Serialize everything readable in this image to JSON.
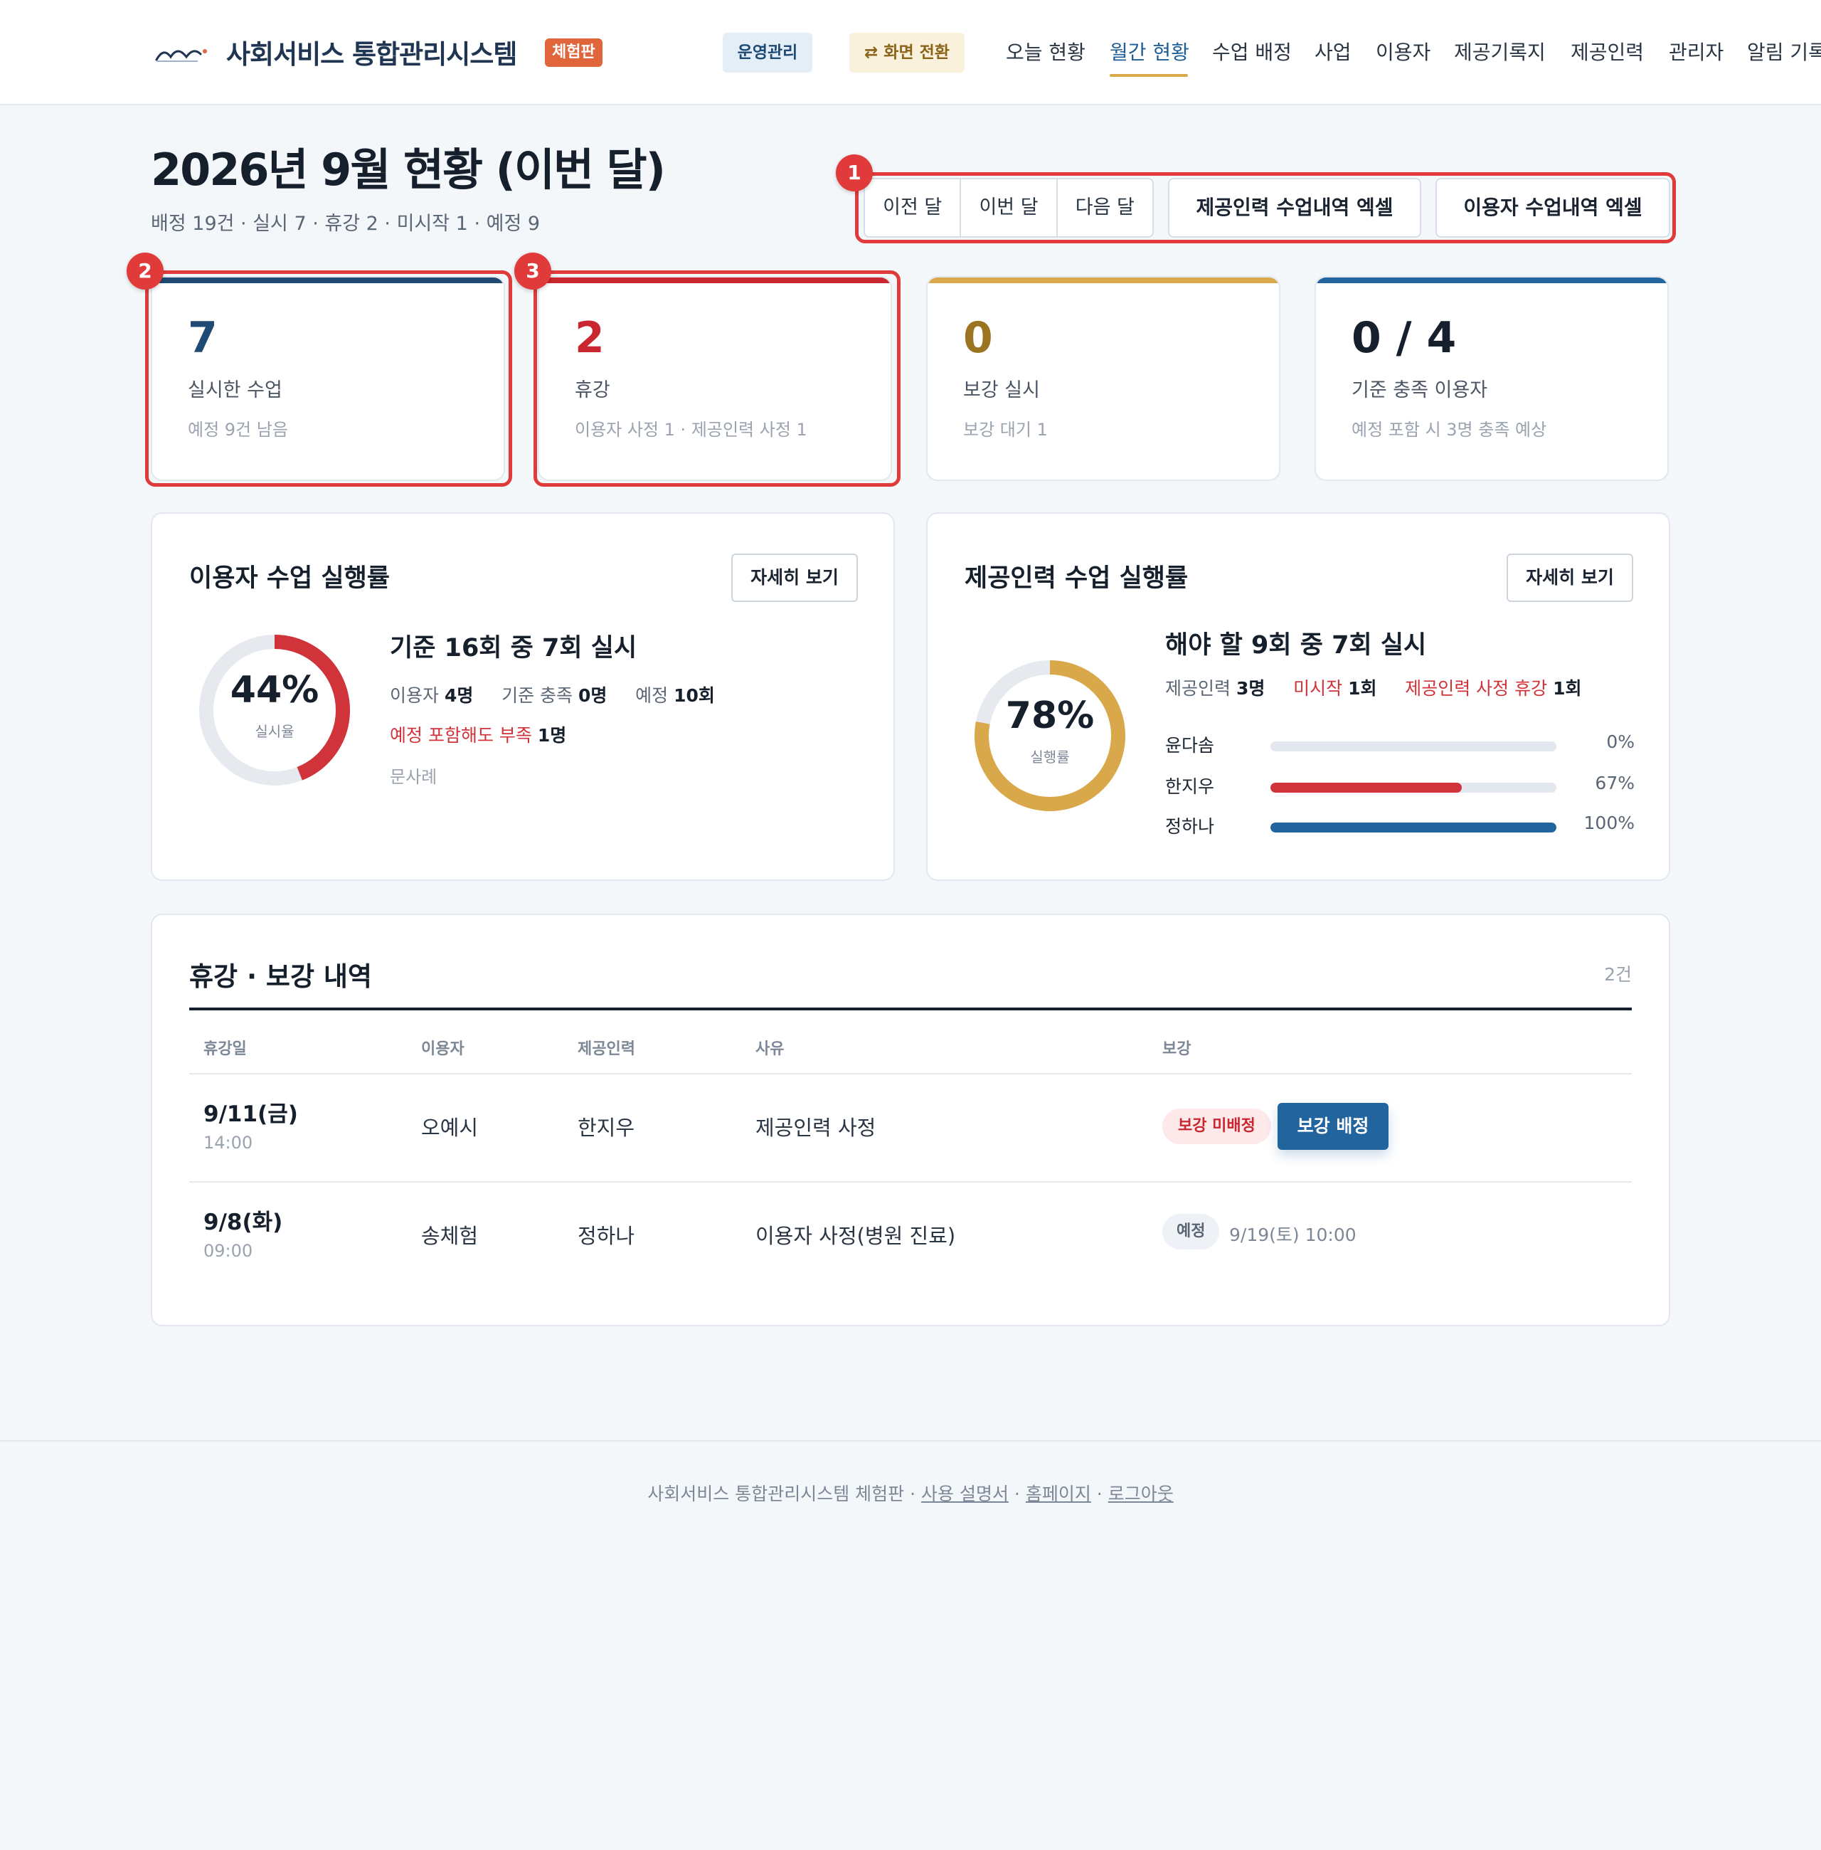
{
  "header": {
    "brand_title": "사회서비스 통합관리시스템",
    "trial_badge": "체험판",
    "ops_button": "운영관리",
    "switch_button": "⇄ 화면 전환",
    "nav": [
      "오늘 현황",
      "월간 현황",
      "수업 배정",
      "사업",
      "이용자",
      "제공기록지",
      "제공인력",
      "관리자",
      "알림 기록"
    ],
    "active_nav": "월간 현황"
  },
  "page": {
    "title": "2026년 9월 현황 (이번 달)",
    "subtitle": "배정 19건 · 실시 7 · 휴강 2 · 미시작 1 · 예정 9",
    "month_buttons": [
      "이전 달",
      "이번 달",
      "다음 달"
    ],
    "excel_provider": "제공인력 수업내역 엑셀",
    "excel_user": "이용자 수업내역 엑셀"
  },
  "annotations": [
    "1",
    "2",
    "3"
  ],
  "stats": [
    {
      "value": "7",
      "label": "실시한 수업",
      "note": "예정 9건 남음",
      "color": "#1f4a74"
    },
    {
      "value": "2",
      "label": "휴강",
      "note": "이용자 사정 1 · 제공인력 사정 1",
      "color": "#c9262f"
    },
    {
      "value": "0",
      "label": "보강 실시",
      "note": "보강 대기 1",
      "color": "#9a7420"
    },
    {
      "value": "0 / 4",
      "label": "기준 충족 이용자",
      "note": "예정 포함 시 3명 충족 예상",
      "color": "#16202c"
    }
  ],
  "user_panel": {
    "title": "이용자 수업 실행률",
    "detail_button": "자세히 보기",
    "donut_pct": "44%",
    "donut_value": 0.44,
    "donut_caption": "실시율",
    "headline": "기준 16회 중 7회 실시",
    "meta_users_label": "이용자",
    "meta_users_value": "4명",
    "meta_met_label": "기준 충족",
    "meta_met_value": "0명",
    "meta_plan_label": "예정",
    "meta_plan_value": "10회",
    "shortfall_label": "예정 포함해도 부족",
    "shortfall_value": "1명",
    "shortfall_name": "문사례"
  },
  "provider_panel": {
    "title": "제공인력 수업 실행률",
    "detail_button": "자세히 보기",
    "donut_pct": "78%",
    "donut_value": 0.78,
    "donut_caption": "실행률",
    "headline": "해야 할 9회 중 7회 실시",
    "meta_staff_label": "제공인력",
    "meta_staff_value": "3명",
    "meta_notstarted_label": "미시작",
    "meta_notstarted_value": "1회",
    "meta_leave_label": "제공인력 사정 휴강",
    "meta_leave_value": "1회",
    "bars": [
      {
        "name": "윤다솜",
        "value": 0,
        "label": "0%",
        "color": "#d0333a"
      },
      {
        "name": "한지우",
        "value": 0.67,
        "label": "67%",
        "color": "#d0333a"
      },
      {
        "name": "정하나",
        "value": 1.0,
        "label": "100%",
        "color": "#22649e"
      }
    ]
  },
  "cancel_table": {
    "title": "휴강 · 보강 내역",
    "count": "2건",
    "headers": [
      "휴강일",
      "이용자",
      "제공인력",
      "사유",
      "보강"
    ],
    "rows": [
      {
        "date": "9/11(금)",
        "time": "14:00",
        "user": "오예시",
        "provider": "한지우",
        "reason": "제공인력 사정",
        "status": "보강 미배정",
        "action": "보강 배정"
      },
      {
        "date": "9/8(화)",
        "time": "09:00",
        "user": "송체험",
        "provider": "정하나",
        "reason": "이용자 사정(병원 진료)",
        "status": "예정",
        "makeup": "9/19(토) 10:00"
      }
    ]
  },
  "footer": {
    "text": "사회서비스 통합관리시스템 체험판",
    "links": [
      "사용 설명서",
      "홈페이지",
      "로그아웃"
    ]
  }
}
